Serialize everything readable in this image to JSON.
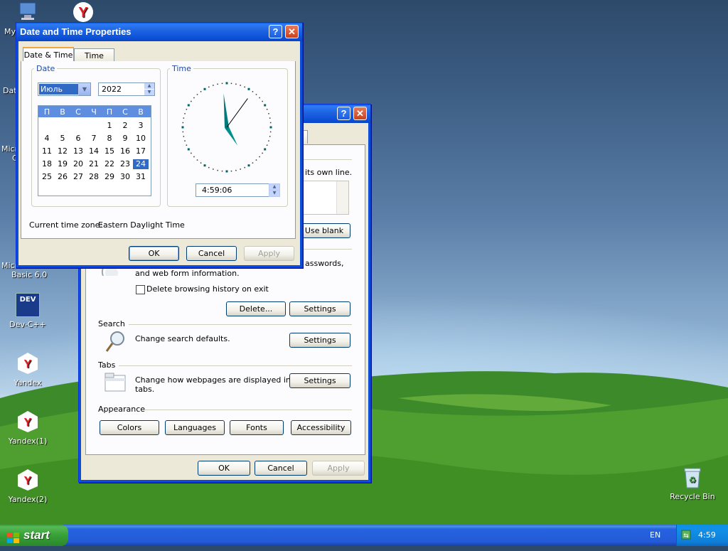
{
  "desktop": {
    "icons": [
      {
        "name": "my-computer",
        "label": "My"
      },
      {
        "name": "yandex-top",
        "label": ""
      },
      {
        "name": "date",
        "label": "Date"
      },
      {
        "name": "micro1",
        "label": "Micro"
      },
      {
        "name": "micro1b",
        "label": "C"
      },
      {
        "name": "vb",
        "label": "Micro"
      },
      {
        "name": "vb2",
        "label": "Basic 6.0"
      },
      {
        "name": "devcpp",
        "label": "Dev-C++"
      },
      {
        "name": "yandex",
        "label": "Yandex"
      },
      {
        "name": "yandex1",
        "label": "Yandex(1)"
      },
      {
        "name": "yandex2",
        "label": "Yandex(2)"
      },
      {
        "name": "recycle",
        "label": "Recycle Bin"
      }
    ],
    "dev_text": "DEV"
  },
  "back_window": {
    "partial_tab": "d",
    "text_own_line": "its own line.",
    "use_blank": "Use blank",
    "text_passwords": "asswords,",
    "text_webform": "and web form information.",
    "delete_history_label": "Delete browsing history on exit",
    "delete_button": "Delete...",
    "settings1": "Settings",
    "search_title": "Search",
    "search_text": "Change search defaults.",
    "settings2": "Settings",
    "tabs_title": "Tabs",
    "tabs_text1": "Change how webpages are displayed in",
    "tabs_text2": "tabs.",
    "settings3": "Settings",
    "appearance_title": "Appearance",
    "colors": "Colors",
    "languages": "Languages",
    "fonts": "Fonts",
    "accessibility": "Accessibility",
    "ok": "OK",
    "cancel": "Cancel",
    "apply": "Apply",
    "help": "?",
    "close": "✕"
  },
  "dt_window": {
    "title": "Date and Time Properties",
    "help": "?",
    "close": "✕",
    "tabs": [
      "Date & Time",
      "Time Zone"
    ],
    "date_group": "Date",
    "time_group": "Time",
    "month": "Июль",
    "year": "2022",
    "weekdays": [
      "П",
      "В",
      "С",
      "Ч",
      "П",
      "С",
      "В"
    ],
    "weeks": [
      [
        "",
        "",
        "",
        "",
        "1",
        "2",
        "3"
      ],
      [
        "4",
        "5",
        "6",
        "7",
        "8",
        "9",
        "10"
      ],
      [
        "11",
        "12",
        "13",
        "14",
        "15",
        "16",
        "17"
      ],
      [
        "18",
        "19",
        "20",
        "21",
        "22",
        "23",
        "24"
      ],
      [
        "25",
        "26",
        "27",
        "28",
        "29",
        "30",
        "31"
      ]
    ],
    "selected_day": "24",
    "time_value": "4:59:06",
    "clock": {
      "hour": 4,
      "minute": 59,
      "second": 6
    },
    "timezone_label": "Current time zone:",
    "timezone_value": "Eastern Daylight Time",
    "ok": "OK",
    "cancel": "Cancel",
    "apply": "Apply"
  },
  "taskbar": {
    "start": "start",
    "lang": "EN",
    "clock": "4:59"
  }
}
